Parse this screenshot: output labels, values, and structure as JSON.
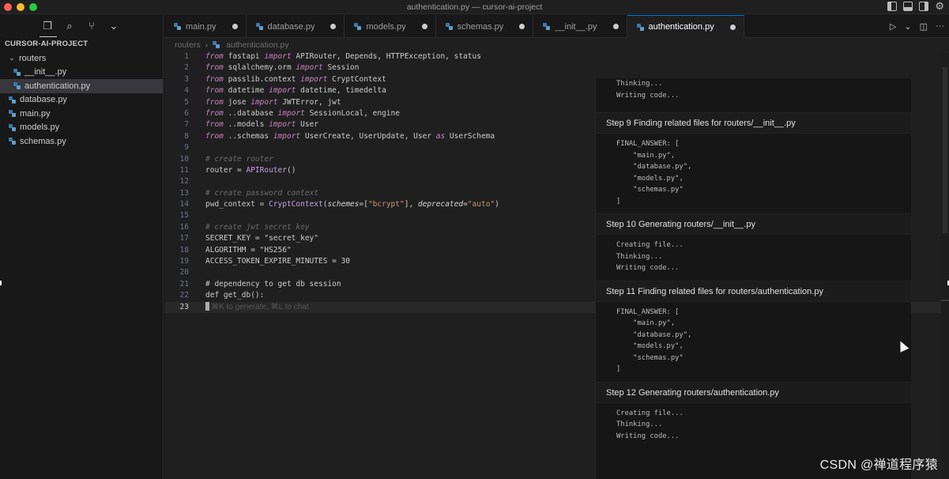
{
  "window": {
    "title": "authentication.py — cursor-ai-project"
  },
  "sidebar": {
    "header": "CURSOR-AI-PROJECT",
    "tree": [
      {
        "label": "routers",
        "kind": "folder"
      },
      {
        "label": "__init__.py",
        "kind": "file-nested"
      },
      {
        "label": "authentication.py",
        "kind": "file-nested",
        "selected": true
      },
      {
        "label": "database.py",
        "kind": "file"
      },
      {
        "label": "main.py",
        "kind": "file"
      },
      {
        "label": "models.py",
        "kind": "file"
      },
      {
        "label": "schemas.py",
        "kind": "file"
      }
    ]
  },
  "tabs": [
    {
      "label": "main.py"
    },
    {
      "label": "database.py"
    },
    {
      "label": "models.py"
    },
    {
      "label": "schemas.py"
    },
    {
      "label": "__init__.py"
    },
    {
      "label": "authentication.py",
      "active": true
    }
  ],
  "breadcrumb": {
    "folder": "routers",
    "file": "authentication.py"
  },
  "code": {
    "line_numbers": [
      "1",
      "2",
      "3",
      "4",
      "5",
      "6",
      "7",
      "8",
      "9",
      "10",
      "11",
      "12",
      "13",
      "14",
      "15",
      "16",
      "17",
      "18",
      "19",
      "20",
      "21",
      "22",
      "23"
    ],
    "l1": {
      "a": "from",
      "b": " fastapi ",
      "c": "import",
      "d": " APIRouter, Depends, HTTPException, status"
    },
    "l2": {
      "a": "from",
      "b": " sqlalchemy.orm ",
      "c": "import",
      "d": " Session"
    },
    "l3": {
      "a": "from",
      "b": " passlib.context ",
      "c": "import",
      "d": " CryptContext"
    },
    "l4": {
      "a": "from",
      "b": " datetime ",
      "c": "import",
      "d": " datetime, timedelta"
    },
    "l5": {
      "a": "from",
      "b": " jose ",
      "c": "import",
      "d": " JWTError, jwt"
    },
    "l6": {
      "a": "from",
      "b": " ..database ",
      "c": "import",
      "d": " SessionLocal, engine"
    },
    "l7": {
      "a": "from",
      "b": " ..models ",
      "c": "import",
      "d": " User"
    },
    "l8": {
      "a": "from",
      "b": " ..schemas ",
      "c": "import",
      "d": " UserCreate, UserUpdate, User ",
      "e": "as",
      "f": " UserSchema"
    },
    "l10": "# create router",
    "l11": {
      "a": "router = ",
      "b": "APIRouter",
      "c": "()"
    },
    "l13": "# create password context",
    "l14": {
      "a": "pwd_context = ",
      "b": "CryptContext",
      "c": "(",
      "d": "schemes",
      "e": "=[",
      "f": "\"bcrypt\"",
      "g": "], ",
      "h": "deprecated",
      "i": "=",
      "j": "\"auto\"",
      "k": ")"
    },
    "l16": "# create jwt secret key",
    "l17": "SECRET_KEY = \"secret_key\"",
    "l18": "ALGORITHM = \"HS256\"",
    "l19": "ACCESS_TOKEN_EXPIRE_MINUTES = 30",
    "l21": "# dependency to get db session",
    "l22": {
      "a": "def get_db",
      "b": "():"
    },
    "l23_hint": "⌘K to generate, ⌘L to chat"
  },
  "panel": {
    "top_log": [
      "Thinking...",
      "Writing code..."
    ],
    "steps": [
      {
        "title": "Step 9  Finding related files for routers/__init__.py",
        "log": [
          "FINAL_ANSWER: [",
          "    \"main.py\",",
          "    \"database.py\",",
          "    \"models.py\",",
          "    \"schemas.py\"",
          "]"
        ]
      },
      {
        "title": "Step 10  Generating routers/__init__.py",
        "log": [
          "Creating file...",
          "Thinking...",
          "Writing code..."
        ]
      },
      {
        "title": "Step 11  Finding related files for routers/authentication.py",
        "log": [
          "FINAL_ANSWER: [",
          "    \"main.py\",",
          "    \"database.py\",",
          "    \"models.py\",",
          "    \"schemas.py\"",
          "]"
        ]
      },
      {
        "title": "Step 12  Generating routers/authentication.py",
        "log": [
          "Creating file...",
          "Thinking...",
          "Writing code..."
        ]
      }
    ]
  },
  "watermark": "CSDN @禅道程序猿",
  "colors": {
    "keyword": "#c586c0",
    "string": "#ce9178",
    "function": "#c1a3e6",
    "comment": "#6a6a6a",
    "accent": "#0078d4"
  }
}
